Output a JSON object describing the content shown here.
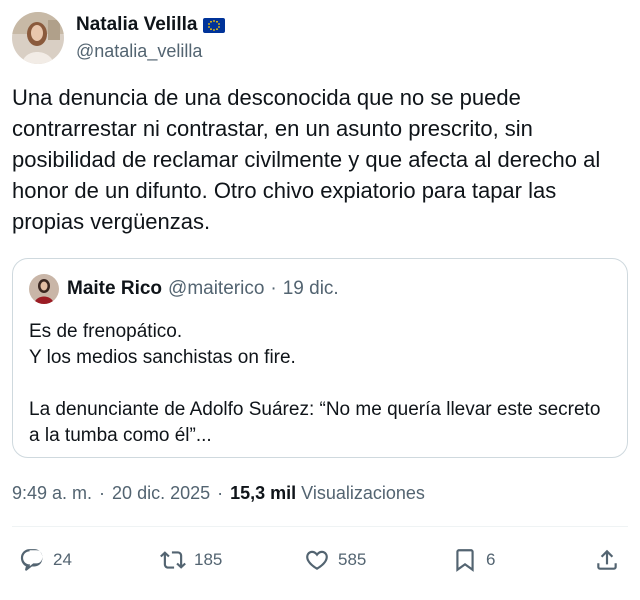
{
  "tweet": {
    "author": {
      "name": "Natalia Velilla",
      "handle": "@natalia_velilla",
      "avatar_icon": "user-avatar-photo",
      "badge_icon": "eu-flag-icon"
    },
    "text": "Una denuncia de una desconocida que no se puede contrarrestar ni contrastar, en un asunto prescrito, sin posibilidad de reclamar civilmente y que afecta al derecho al honor de un difunto. Otro chivo expiatorio para tapar las propias vergüenzas.",
    "quote": {
      "name": "Maite Rico",
      "handle": "@maiterico",
      "separator": "·",
      "date": "19 dic.",
      "text": "Es de frenopático.\nY los medios sanchistas on fire.\n\nLa denunciante de Adolfo Suárez: “No me quería llevar este secreto a la tumba como él”..."
    },
    "meta": {
      "time": "9:49 a. m.",
      "dot1": "·",
      "date": "20 dic. 2025",
      "dot2": "·",
      "views_count": "15,3 mil",
      "views_label": "Visualizaciones"
    },
    "actions": {
      "replies": "24",
      "retweets": "185",
      "likes": "585",
      "bookmarks": "6"
    }
  },
  "colors": {
    "text": "#0f1419",
    "secondary": "#536471",
    "border": "#cfd9de",
    "eu_blue": "#003399",
    "eu_gold": "#ffcc00"
  }
}
